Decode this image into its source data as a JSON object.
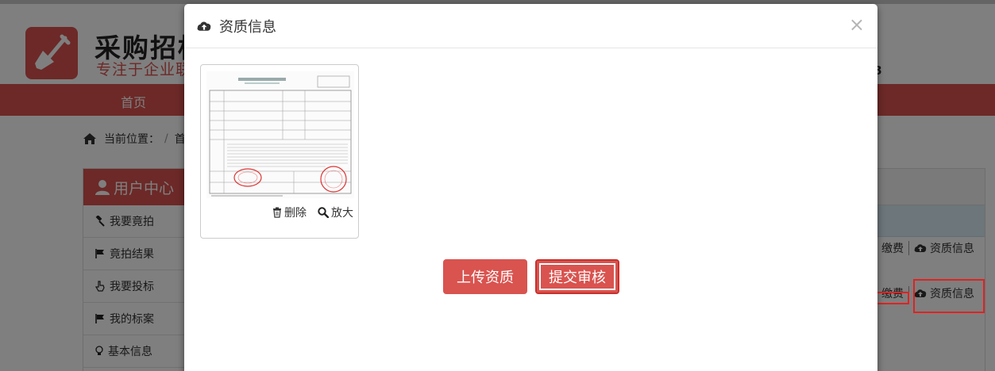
{
  "site": {
    "name": "采购招标",
    "slogan": "专注于企业联",
    "hotline": "8"
  },
  "nav": {
    "home": "首页"
  },
  "breadcrumb": {
    "label": "当前位置：",
    "sep": "/",
    "first": "首"
  },
  "sidebar": {
    "title": "用户中心",
    "items": [
      {
        "label": "我要竟拍",
        "icon": "gavel-icon"
      },
      {
        "label": "竟拍结果",
        "icon": "flag-icon"
      },
      {
        "label": "我要投标",
        "icon": "hand-pointer-icon"
      },
      {
        "label": "我的标案",
        "icon": "flag-icon"
      },
      {
        "label": "基本信息",
        "icon": "lightbulb-icon"
      }
    ]
  },
  "table_rows": [
    {
      "pay_label": "缴费",
      "info_label": "资质信息"
    },
    {
      "pay_label": "缴费",
      "info_label": "资质信息"
    }
  ],
  "modal": {
    "title": "资质信息",
    "close": "×",
    "thumbnail": {
      "delete_label": "删除",
      "zoom_label": "放大"
    },
    "upload_button": "上传资质",
    "submit_button": "提交审核"
  },
  "colors": {
    "brand": "#d9534f",
    "overlay": "rgba(0,0,0,0.5)",
    "annotation": "#e02222"
  }
}
